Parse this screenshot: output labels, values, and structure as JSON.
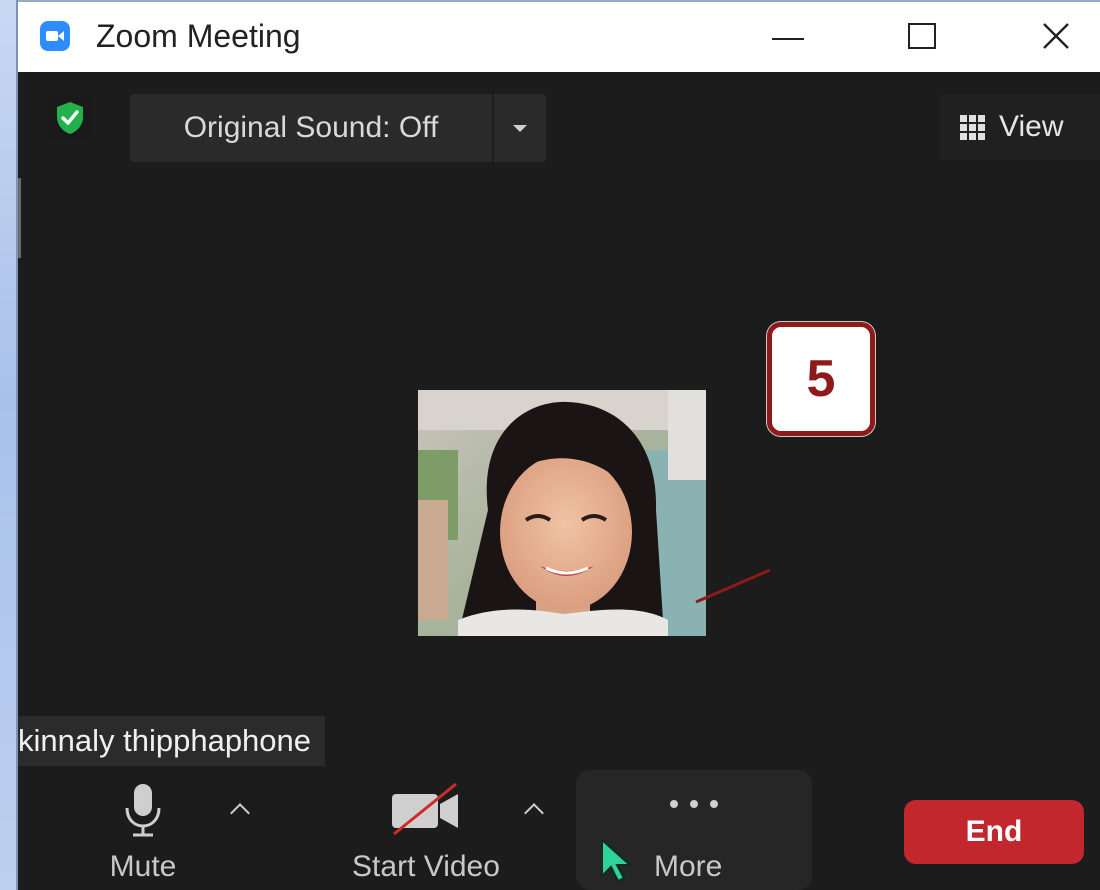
{
  "window": {
    "title": "Zoom Meeting",
    "app_icon": "zoom-camera-icon"
  },
  "top_toolbar": {
    "security_icon": "green-shield-check-icon",
    "original_sound_label": "Original Sound: Off",
    "view_label": "View"
  },
  "video": {
    "participant_name": "kinnaly thipphaphone",
    "callout_number": "5"
  },
  "bottom_toolbar": {
    "mute_label": "Mute",
    "start_video_label": "Start Video",
    "more_label": "More",
    "end_label": "End"
  },
  "colors": {
    "window_bg": "#1c1c1c",
    "toolbar_button_bg": "#2a2a2a",
    "end_button": "#c1272d",
    "callout_border": "#8f1a1a",
    "shield_green": "#23b14d",
    "zoom_blue": "#2d8cff",
    "cursor_green": "#2fd29a"
  }
}
